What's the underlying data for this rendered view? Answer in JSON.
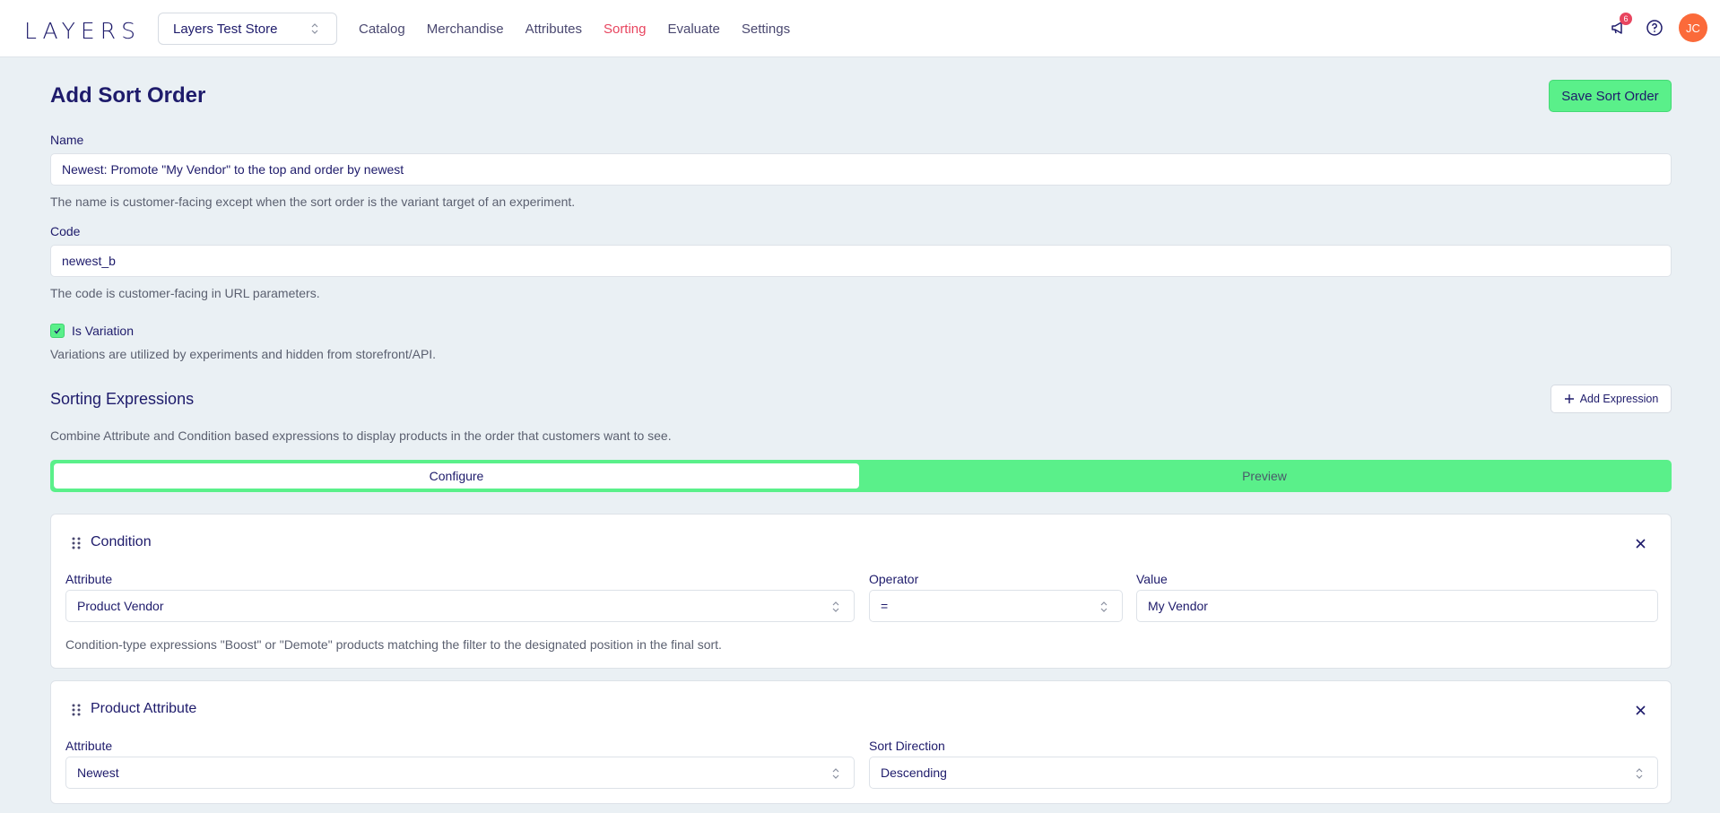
{
  "brand": {
    "logo": "LAYERS",
    "accent": "#5af08a",
    "active_nav": "#e8455f",
    "avatar_bg": "#fb6a3a"
  },
  "store_selector": {
    "value": "Layers Test Store"
  },
  "nav": {
    "catalog": "Catalog",
    "merchandise": "Merchandise",
    "attributes": "Attributes",
    "sorting": "Sorting",
    "evaluate": "Evaluate",
    "settings": "Settings"
  },
  "header_icons": {
    "notifications_icon": "megaphone-icon",
    "notifications_count": "6",
    "help_icon": "help-circle-icon",
    "avatar_initials": "JC"
  },
  "page": {
    "title": "Add Sort Order",
    "save_label": "Save Sort Order"
  },
  "form": {
    "name_label": "Name",
    "name_value": "Newest: Promote \"My Vendor\" to the top and order by newest",
    "name_help": "The name is customer-facing except when the sort order is the variant target of an experiment.",
    "code_label": "Code",
    "code_value": "newest_b",
    "code_help": "The code is customer-facing in URL parameters.",
    "variation_label": "Is Variation",
    "variation_checked": true,
    "variation_help": "Variations are utilized by experiments and hidden from storefront/API."
  },
  "expressions": {
    "title": "Sorting Expressions",
    "add_label": "Add Expression",
    "description": "Combine Attribute and Condition based expressions to display products in the order that customers want to see.",
    "tabs": {
      "configure": "Configure",
      "preview": "Preview"
    }
  },
  "condition_card": {
    "title": "Condition",
    "attribute_label": "Attribute",
    "attribute_value": "Product Vendor",
    "operator_label": "Operator",
    "operator_value": "=",
    "value_label": "Value",
    "value_value": "My Vendor",
    "help": "Condition-type expressions \"Boost\" or \"Demote\" products matching the filter to the designated position in the final sort."
  },
  "attribute_card": {
    "title": "Product Attribute",
    "attribute_label": "Attribute",
    "attribute_value": "Newest",
    "direction_label": "Sort Direction",
    "direction_value": "Descending"
  }
}
